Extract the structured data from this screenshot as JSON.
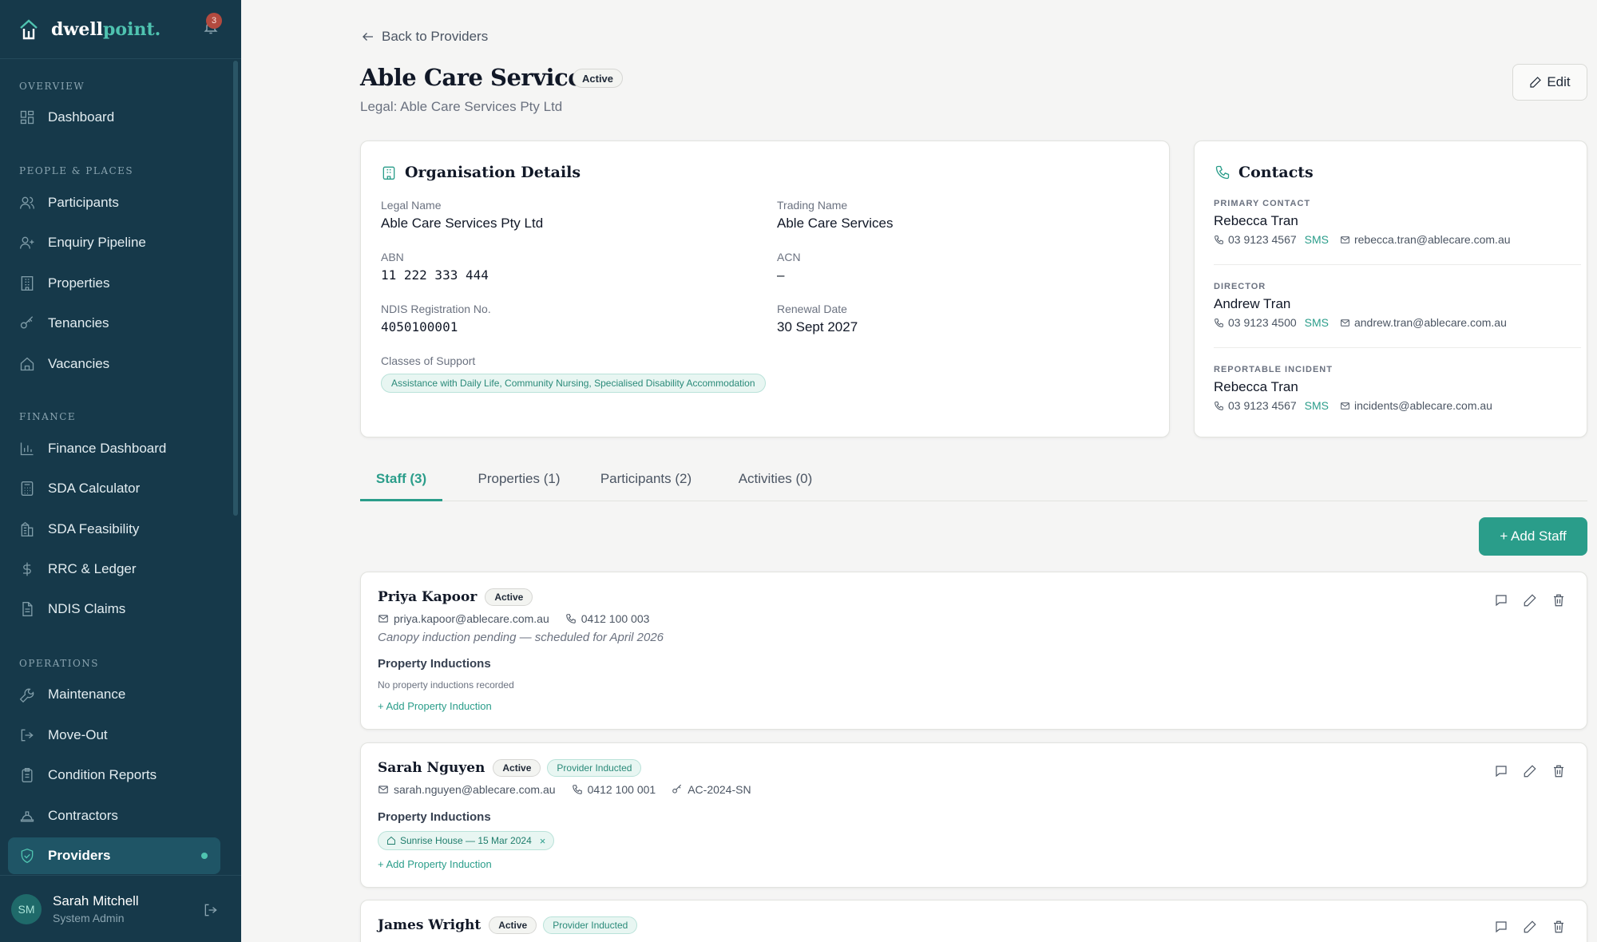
{
  "brand": {
    "name_part1": "dwell",
    "name_part2": "point.",
    "notifications": "3"
  },
  "sidebar": {
    "sections": {
      "overview": "OVERVIEW",
      "people": "PEOPLE & PLACES",
      "finance": "FINANCE",
      "operations": "OPERATIONS"
    },
    "items": [
      {
        "label": "Dashboard",
        "icon": "grid-icon"
      },
      {
        "label": "Participants",
        "icon": "users-icon"
      },
      {
        "label": "Enquiry Pipeline",
        "icon": "user-plus-icon"
      },
      {
        "label": "Properties",
        "icon": "building-icon"
      },
      {
        "label": "Tenancies",
        "icon": "key-icon"
      },
      {
        "label": "Vacancies",
        "icon": "home-icon"
      },
      {
        "label": "Finance Dashboard",
        "icon": "bar-chart-icon"
      },
      {
        "label": "SDA Calculator",
        "icon": "calculator-icon"
      },
      {
        "label": "SDA Feasibility",
        "icon": "building-icon"
      },
      {
        "label": "RRC & Ledger",
        "icon": "dollar-icon"
      },
      {
        "label": "NDIS Claims",
        "icon": "file-icon"
      },
      {
        "label": "Maintenance",
        "icon": "wrench-icon"
      },
      {
        "label": "Move-Out",
        "icon": "logout-icon"
      },
      {
        "label": "Condition Reports",
        "icon": "clipboard-icon"
      },
      {
        "label": "Contractors",
        "icon": "hardhat-icon"
      },
      {
        "label": "Providers",
        "icon": "shield-icon"
      }
    ],
    "active": "Providers"
  },
  "user": {
    "initials": "SM",
    "name": "Sarah Mitchell",
    "role": "System Admin"
  },
  "page": {
    "back": "Back to Providers",
    "title": "Able Care Services",
    "status": "Active",
    "legal_sub": "Legal: Able Care Services Pty Ltd",
    "edit": "Edit"
  },
  "org": {
    "title": "Organisation Details",
    "legal_name_label": "Legal Name",
    "legal_name": "Able Care Services Pty Ltd",
    "trading_name_label": "Trading Name",
    "trading_name": "Able Care Services",
    "abn_label": "ABN",
    "abn": "11 222 333 444",
    "acn_label": "ACN",
    "acn": "–",
    "ndis_label": "NDIS Registration No.",
    "ndis": "4050100001",
    "renewal_label": "Renewal Date",
    "renewal": "30 Sept 2027",
    "classes_label": "Classes of Support",
    "classes": "Assistance with Daily Life, Community Nursing, Specialised Disability Accommodation"
  },
  "contacts": {
    "title": "Contacts",
    "sms": "SMS",
    "list": [
      {
        "role": "PRIMARY CONTACT",
        "name": "Rebecca Tran",
        "phone": "03 9123 4567",
        "email": "rebecca.tran@ablecare.com.au"
      },
      {
        "role": "DIRECTOR",
        "name": "Andrew Tran",
        "phone": "03 9123 4500",
        "email": "andrew.tran@ablecare.com.au"
      },
      {
        "role": "REPORTABLE INCIDENT",
        "name": "Rebecca Tran",
        "phone": "03 9123 4567",
        "email": "incidents@ablecare.com.au"
      }
    ]
  },
  "tabs": [
    "Staff (3)",
    "Properties (1)",
    "Participants (2)",
    "Activities (0)"
  ],
  "add_staff": "+ Add Staff",
  "staff_common": {
    "inductions_heading": "Property Inductions",
    "add_induction": "+ Add Property Induction",
    "active": "Active",
    "provider_inducted": "Provider Inducted"
  },
  "staff": [
    {
      "name": "Priya Kapoor",
      "email": "priya.kapoor@ablecare.com.au",
      "phone": "0412 100 003",
      "note": "Canopy induction pending — scheduled for April 2026",
      "no_inductions": "No property inductions recorded"
    },
    {
      "name": "Sarah Nguyen",
      "email": "sarah.nguyen@ablecare.com.au",
      "phone": "0412 100 001",
      "key_code": "AC-2024-SN",
      "induction": "Sunrise House — 15 Mar 2024"
    },
    {
      "name": "James Wright"
    }
  ]
}
